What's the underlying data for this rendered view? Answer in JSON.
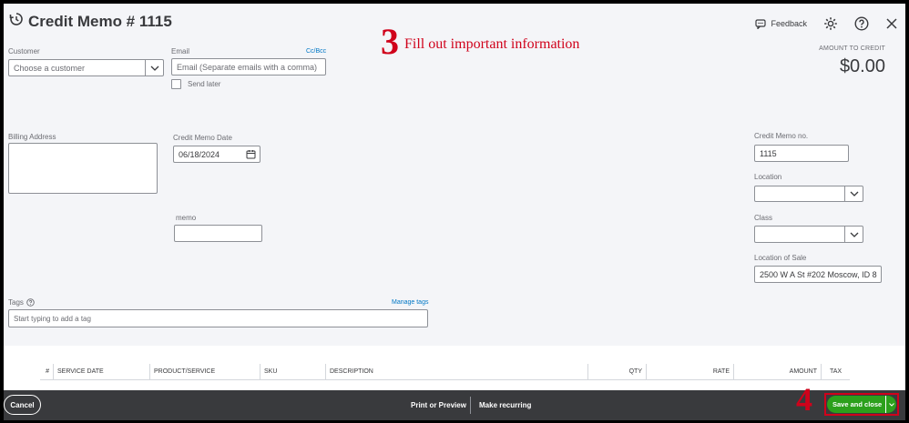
{
  "header": {
    "title": "Credit Memo # 1115",
    "feedback_label": "Feedback",
    "amount_label": "AMOUNT TO CREDIT",
    "amount_value": "$0.00"
  },
  "annotations": {
    "step3_number": "3",
    "step3_text": "Fill out important information",
    "step4_number": "4"
  },
  "form": {
    "customer_label": "Customer",
    "customer_placeholder": "Choose a customer",
    "email_label": "Email",
    "email_placeholder": "Email (Separate emails with a comma)",
    "ccbcc_label": "Cc/Bcc",
    "send_later_label": "Send later",
    "billing_label": "Billing Address",
    "date_label": "Credit Memo Date",
    "date_value": "06/18/2024",
    "memo_label": "memo",
    "memo_no_label": "Credit Memo no.",
    "memo_no_value": "1115",
    "location_label": "Location",
    "class_label": "Class",
    "location_sale_label": "Location of Sale",
    "location_sale_value": "2500 W A St #202 Moscow, ID 8",
    "tags_label": "Tags",
    "manage_tags": "Manage tags",
    "tags_placeholder": "Start typing to add a tag"
  },
  "table": {
    "columns": [
      "#",
      "SERVICE DATE",
      "PRODUCT/SERVICE",
      "SKU",
      "DESCRIPTION",
      "QTY",
      "RATE",
      "AMOUNT",
      "TAX"
    ]
  },
  "footer": {
    "cancel": "Cancel",
    "print_preview": "Print or Preview",
    "make_recurring": "Make recurring",
    "save_close": "Save and close"
  },
  "colors": {
    "brand_green": "#2ca01c",
    "annotation_red": "#d0021b",
    "footer_bg": "#393a3d"
  }
}
